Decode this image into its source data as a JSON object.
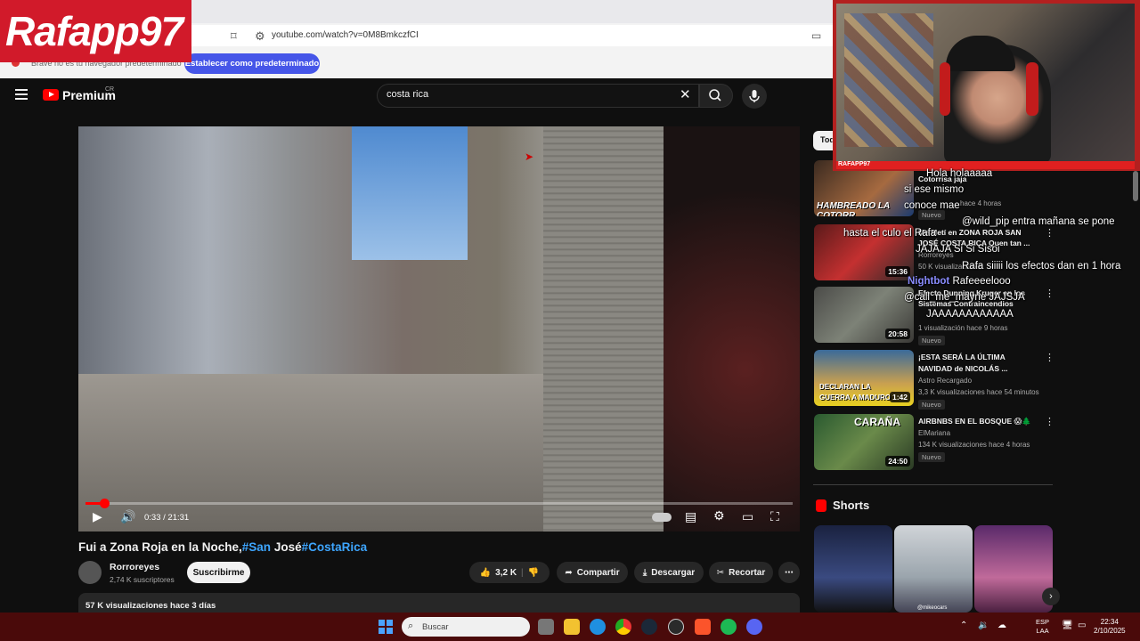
{
  "browser": {
    "url": "youtube.com/watch?v=0M8BmkczfCI",
    "infobar_text": "Brave no es tu navegador predeterminado",
    "default_button": "Establecer como predeterminado"
  },
  "overlay": {
    "logo_text": "Rafapp97",
    "webcam_tag": "RAFAPP97"
  },
  "youtube": {
    "premium_label": "Premium",
    "region_code": "CR",
    "search_query": "costa rica",
    "player": {
      "time": "0:33 / 21:31",
      "progress": 0.026
    },
    "video": {
      "title_main": "Fui a Zona Roja en la Noche,",
      "tag1": "#San",
      "title_mid": " José",
      "tag2": "#CostaRica",
      "channel": "Rorroreyes",
      "subscribers": "2,74 K suscriptores",
      "subscribe_label": "Suscribirme",
      "likes": "3,2 K",
      "share_label": "Compartir",
      "download_label": "Descargar",
      "clip_label": "Recortar",
      "views_line": "57 K visualizaciones  hace 3 días"
    },
    "chip_label": "Todo",
    "recommendations": [
      {
        "title_line1": "Cotorrisa jaja",
        "title_line2": "",
        "channel": "",
        "meta": "hace 4 horas",
        "badge": "Nuevo",
        "duration": ""
      },
      {
        "title_line1": "Me Metí en ZONA ROJA SAN",
        "title_line2": "JOSÉ COSTA RICA Quen tan ...",
        "channel": "Rorroreyes",
        "meta": "50 K visualizaciones",
        "badge": "",
        "duration": "15:36"
      },
      {
        "title_line1": "Efecto Dunning Kruger en los",
        "title_line2": "Sistemas Contraincendios",
        "channel": "",
        "meta": "1 visualización  hace 9 horas",
        "badge": "Nuevo",
        "duration": "20:58"
      },
      {
        "title_line1": "¡ESTA SERÁ LA ÚLTIMA",
        "title_line2": "NAVIDAD de NICOLÁS ...",
        "channel": "Astro Recargado",
        "meta": "3,3 K visualizaciones  hace 54 minutos",
        "badge": "Nuevo",
        "duration": "1:42"
      },
      {
        "title_line1": "AIRBNBS EN EL BOSQUE 😱🌲",
        "title_line2": "",
        "channel": "ElMariana",
        "meta": "134 K visualizaciones  hace 4 horas",
        "badge": "Nuevo",
        "duration": "24:50"
      }
    ],
    "thumb_captions": [
      "HAMBREADO LA COTORR",
      "",
      "",
      "DECLARAN LA GUERRA A MADURO",
      "CARAÑA"
    ],
    "shorts_label": "Shorts",
    "shorts_caption": "@mikeocars"
  },
  "chat": [
    {
      "user": "",
      "text": "Hola holaaaaa"
    },
    {
      "user": "",
      "text": "si ese mismo"
    },
    {
      "user": "",
      "text": "conoce mae"
    },
    {
      "user": "",
      "text": "@wild_pip entra mañana se pone"
    },
    {
      "user": "",
      "text": "hasta el culo el Rafa"
    },
    {
      "user": "",
      "text": "JAJAJA Si Si Sisoi"
    },
    {
      "user": "",
      "text": "Rafa siiiii los efectos dan en 1 hora"
    },
    {
      "user": "Nightbot",
      "text": "Rafeeeelooo"
    },
    {
      "user": "",
      "text": "@call_me_mayne JAJSJA"
    },
    {
      "user": "",
      "text": "JAAAAAAAAAAAA"
    }
  ],
  "taskbar": {
    "search_placeholder": "Buscar",
    "lang_line1": "ESP",
    "lang_line2": "LAA",
    "time": "22:34",
    "date": "2/10/2025"
  },
  "colors": {
    "accent_red": "#ff0000",
    "link_blue": "#3ea6ff",
    "overlay_red": "#d11a2a",
    "taskbar": "#4a0a0a"
  }
}
